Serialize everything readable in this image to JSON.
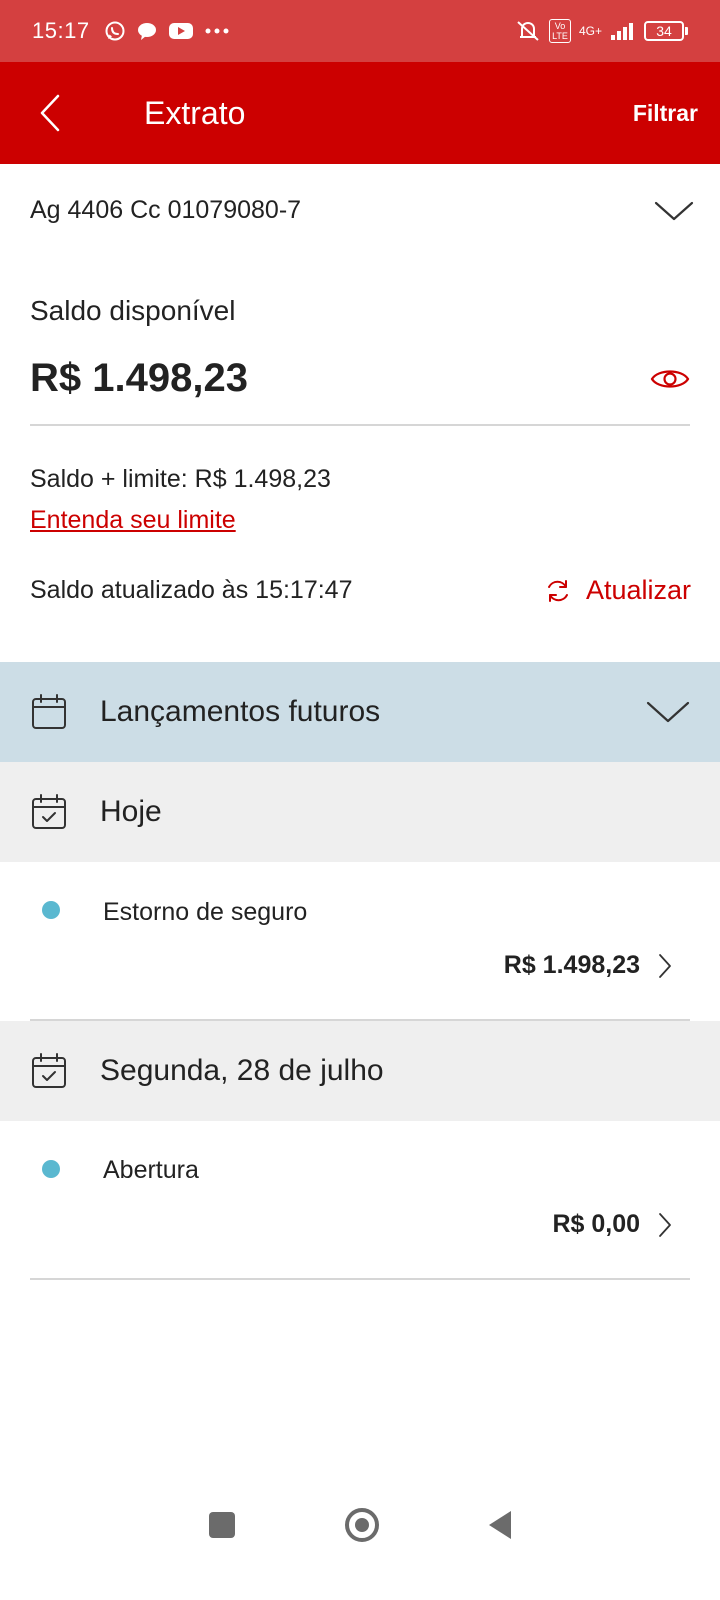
{
  "status_bar": {
    "time": "15:17",
    "icons_left": [
      "whatsapp-icon",
      "chat-icon",
      "youtube-icon",
      "more-dots-icon"
    ],
    "network": "4G+",
    "volte": "Vo LTE",
    "battery": "34"
  },
  "header": {
    "title": "Extrato",
    "filter_label": "Filtrar"
  },
  "account": {
    "label": "Ag 4406  Cc 01079080-7"
  },
  "balance": {
    "label": "Saldo disponível",
    "value": "R$ 1.498,23"
  },
  "limit": {
    "text": "Saldo + limite: R$ 1.498,23",
    "link": "Entenda seu limite"
  },
  "update": {
    "text": "Saldo atualizado às 15:17:47",
    "button_label": "Atualizar"
  },
  "future": {
    "label": "Lançamentos futuros"
  },
  "days": [
    {
      "label": "Hoje",
      "transactions": [
        {
          "description": "Estorno de seguro",
          "amount": "R$ 1.498,23"
        }
      ]
    },
    {
      "label": "Segunda, 28 de julho",
      "transactions": [
        {
          "description": "Abertura",
          "amount": "R$ 0,00"
        }
      ]
    }
  ],
  "colors": {
    "brand_red": "#cc0000",
    "status_red": "#d44040",
    "future_bg": "#ccdde6",
    "day_bg": "#efefef",
    "dot": "#5ab8d0"
  }
}
